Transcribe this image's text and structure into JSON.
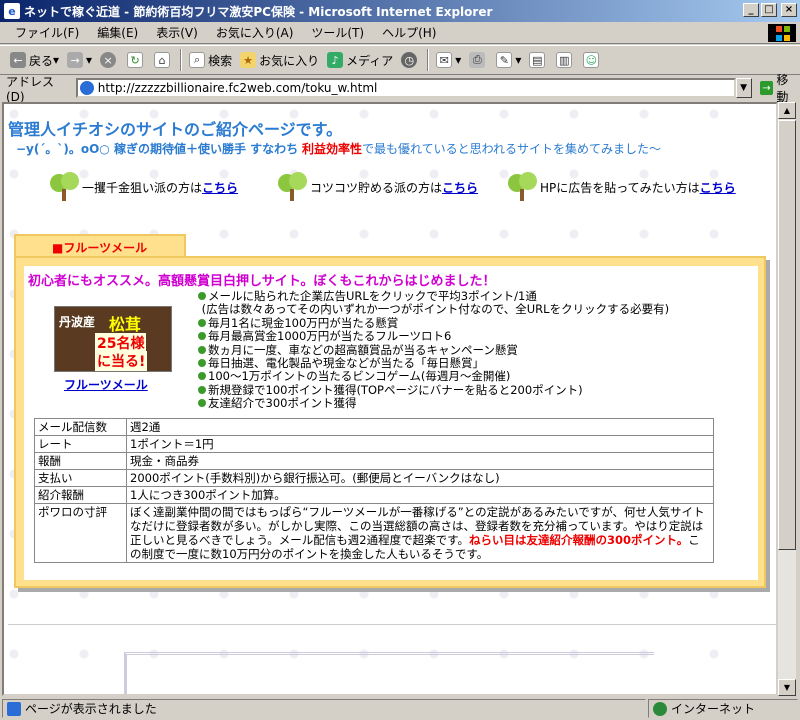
{
  "window": {
    "title": "ネットで稼ぐ近道 - 節約術百均フリマ激安PC保険 - Microsoft Internet Explorer",
    "min": "_",
    "max": "□",
    "close": "×"
  },
  "menu": [
    "ファイル(F)",
    "編集(E)",
    "表示(V)",
    "お気に入り(A)",
    "ツール(T)",
    "ヘルプ(H)"
  ],
  "toolbar": {
    "back": "戻る",
    "search": "検索",
    "favorites": "お気に入り",
    "media": "メディア"
  },
  "address": {
    "label": "アドレス(D)",
    "url": "http://zzzzzbillionaire.fc2web.com/toku_w.html",
    "go": "移動"
  },
  "page": {
    "heading": "管理人イチオシのサイトのご紹介ページです。",
    "sub_prefix": "−y(´。`)。oO○ 稼ぎの期待値＋使い勝手 すなわち",
    "sub_red": "利益効率性",
    "sub_suffix": "で最も優れていると思われるサイトを集めてみました〜",
    "links": [
      {
        "text": "一攫千金狙い派の方は",
        "link": "こちら"
      },
      {
        "text": "コツコツ貯める派の方は",
        "link": "こちら"
      },
      {
        "text": "HPに広告を貼ってみたい方は",
        "link": "こちら"
      }
    ],
    "tab": "■フルーツメール",
    "headline": "初心者にもオススメ。高額懸賞目白押しサイト。ぼくもこれからはじめました！",
    "banner": {
      "line1": "丹波産",
      "line2": "松茸",
      "line3": "25名様",
      "line4": "に当る!",
      "link": "フルーツメール"
    },
    "bullets": [
      "メールに貼られた企業広告URLをクリックで平均3ポイント/1通",
      "(広告は数々あってその内いずれか一つがポイント付なので、全URLをクリックする必要有)",
      "毎月1名に現金100万円が当たる懸賞",
      "毎月最高賞金1000万円が当たるフルーツロト6",
      "数ヵ月に一度、車などの超高額賞品が当るキャンペーン懸賞",
      "毎日抽選、電化製品や現金などが当たる「毎日懸賞」",
      "100〜1万ポイントの当たるビンコゲーム(毎週月〜金開催)",
      "新規登録で100ポイント獲得(TOPページにバナーを貼ると200ポイント)",
      "友達紹介で300ポイント獲得"
    ],
    "table": [
      {
        "k": "メール配信数",
        "v": "週2通"
      },
      {
        "k": "レート",
        "v": "1ポイント＝1円"
      },
      {
        "k": "報酬",
        "v": "現金・商品券"
      },
      {
        "k": "支払い",
        "v": "2000ポイント(手数料別)から銀行振込可。(郵便局とイーバンクはなし)"
      },
      {
        "k": "紹介報酬",
        "v": "1人につき300ポイント加算。"
      }
    ],
    "review_key": "ポワロの寸評",
    "review_1": "ぼく達副業仲間の間ではもっぱら“フルーツメールが一番稼げる”との定説があるみたいですが、何せ人気サイトなだけに登録者数が多い。がしかし実際、この当選総額の高さは、登録者数を充分補っています。やはり定説は正しいと見るべきでしょう。メール配信も週2通程度で超楽です。",
    "review_red": "ねらい目は友達紹介報酬の300ポイント。",
    "review_2": "この制度で一度に数10万円分のポイントを換金した人もいるそうです。"
  },
  "status": {
    "left": "ページが表示されました",
    "right": "インターネット"
  }
}
